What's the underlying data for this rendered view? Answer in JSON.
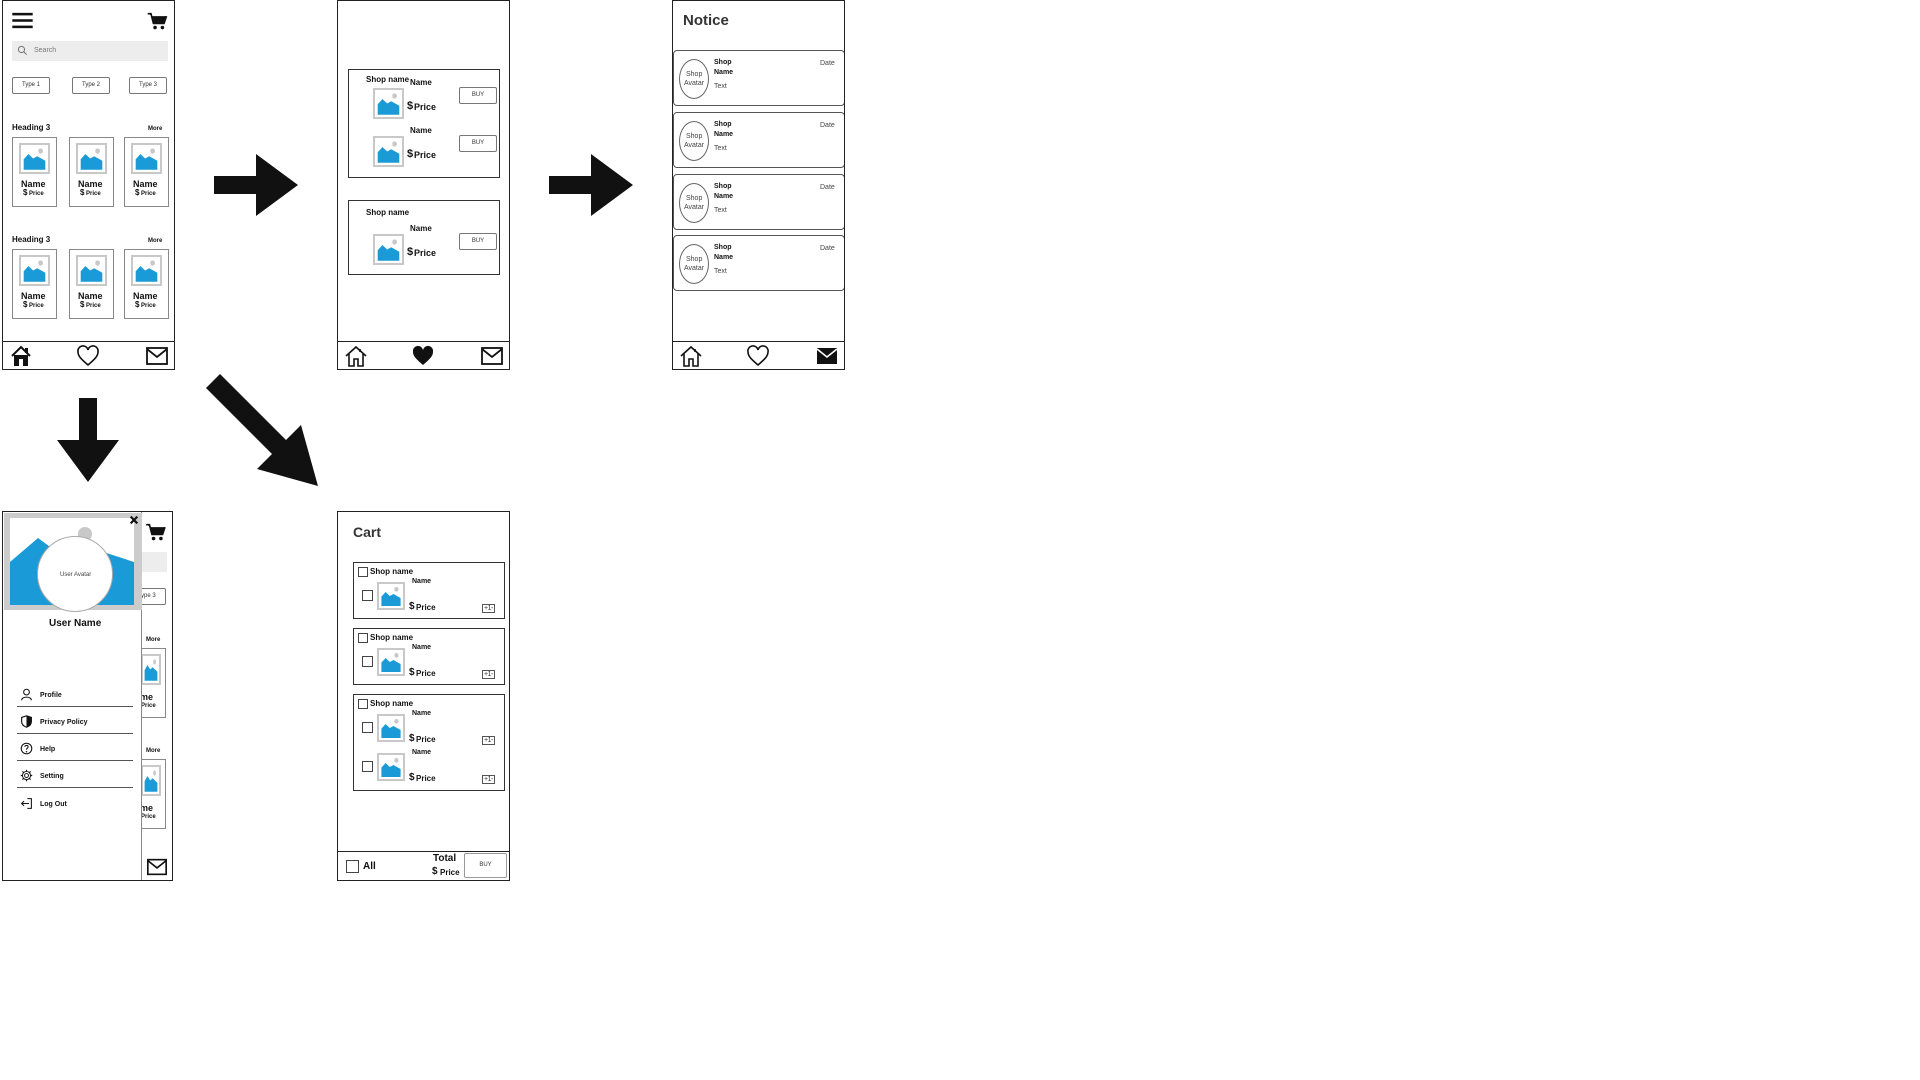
{
  "home": {
    "search_placeholder": "Search",
    "types": [
      "Type 1",
      "Type 2",
      "Type 3"
    ],
    "sections": [
      {
        "heading": "Heading 3",
        "more": "More"
      },
      {
        "heading": "Heading 3",
        "more": "More"
      }
    ],
    "product_name": "Name",
    "product_price": "Price",
    "currency": "$"
  },
  "favorites": {
    "shop_name": "Shop name",
    "item_name": "Name",
    "item_price": "Price",
    "currency": "$",
    "buy_label": "BUY"
  },
  "notice": {
    "title": "Notice",
    "avatar_line1": "Shop",
    "avatar_line2": "Avatar",
    "shop_line1": "Shop",
    "shop_line2": "Name",
    "text": "Text",
    "date": "Date"
  },
  "drawer": {
    "avatar_label": "User Avatar",
    "user_name": "User Name",
    "menu": [
      "Profile",
      "Privacy Policy",
      "Help",
      "Setting",
      "Log Out"
    ],
    "partial_type": "ype 3",
    "partial_more": "More",
    "partial_name": "me",
    "partial_price": "Price"
  },
  "cart": {
    "title": "Cart",
    "shop_name": "Shop name",
    "item_name": "Name",
    "item_price": "Price",
    "currency": "$",
    "qty": "+1-",
    "all_label": "All",
    "total_label": "Total",
    "total_price": "Price",
    "buy_label": "BUY"
  },
  "colors": {
    "image_blue": "#1a9bd7",
    "image_sun": "#c8c8c8",
    "outline": "#222222"
  }
}
